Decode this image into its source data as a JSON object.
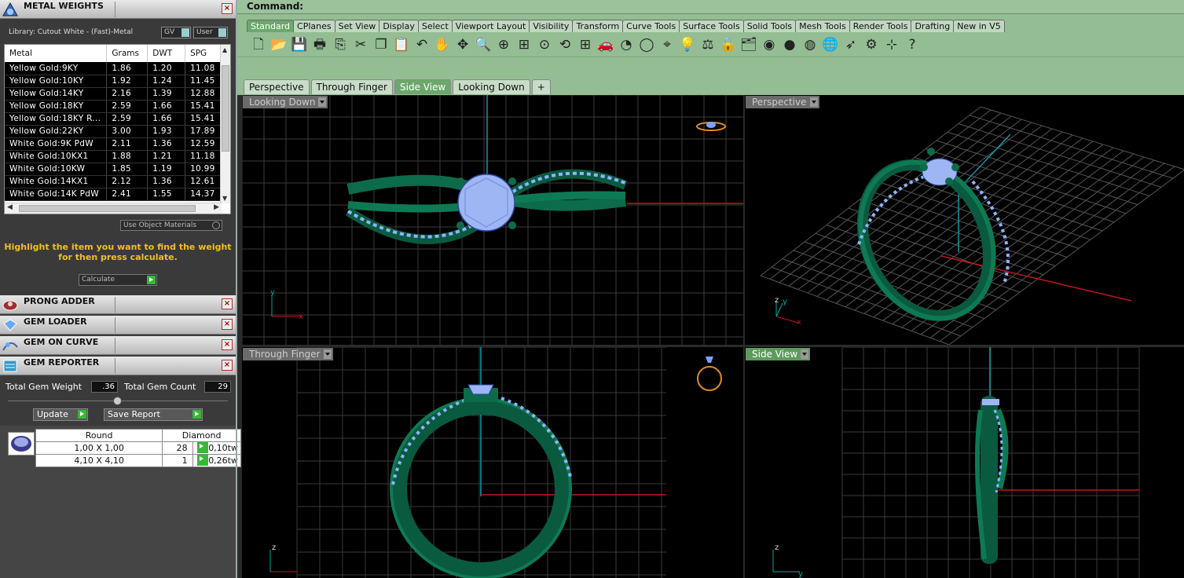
{
  "colors": {
    "accent": "#6ca86c",
    "ring": "#0c6b4a",
    "gem": "#a8c4ff",
    "hint": "#f0c020"
  },
  "metal_weights": {
    "title": "METAL WEIGHTS",
    "library": "Library: Cutout White - (Fast)-Metal",
    "gv": "GV",
    "user": "User",
    "headers": [
      "Metal",
      "Grams",
      "DWT",
      "SPG"
    ],
    "rows": [
      [
        "Yellow Gold:9KY",
        "1.86",
        "1.20",
        "11.08"
      ],
      [
        "Yellow Gold:10KY",
        "1.92",
        "1.24",
        "11.45"
      ],
      [
        "Yellow Gold:14KY",
        "2.16",
        "1.39",
        "12.88"
      ],
      [
        "Yellow Gold:18KY",
        "2.59",
        "1.66",
        "15.41"
      ],
      [
        "Yellow Gold:18KY R...",
        "2.59",
        "1.66",
        "15.41"
      ],
      [
        "Yellow Gold:22KY",
        "3.00",
        "1.93",
        "17.89"
      ],
      [
        "White Gold:9K PdW",
        "2.11",
        "1.36",
        "12.59"
      ],
      [
        "White Gold:10KX1",
        "1.88",
        "1.21",
        "11.18"
      ],
      [
        "White Gold:10KW",
        "1.85",
        "1.19",
        "10.99"
      ],
      [
        "White Gold:14KX1",
        "2.12",
        "1.36",
        "12.61"
      ],
      [
        "White Gold:14K PdW",
        "2.41",
        "1.55",
        "14.37"
      ]
    ],
    "use_object": "Use Object Materials",
    "hint1": "Highlight the item you want to find the weight",
    "hint2": "for then press calculate.",
    "calculate": "Calculate"
  },
  "panels": {
    "prong": "PRONG ADDER",
    "loader": "GEM LOADER",
    "curve": "GEM ON CURVE",
    "reporter": "GEM REPORTER"
  },
  "gem_reporter": {
    "total_weight_label": "Total Gem Weight",
    "total_weight": ".36",
    "total_count_label": "Total Gem Count",
    "total_count": "29",
    "update": "Update",
    "save": "Save Report",
    "headers": [
      "Round",
      "Diamond"
    ],
    "rows": [
      [
        "1,00 X 1,00",
        "28",
        "0,10tw"
      ],
      [
        "4,10 X 4,10",
        "1",
        "0,26tw"
      ]
    ]
  },
  "command_label": "Command:",
  "toolbar_tabs": [
    "Standard",
    "CPlanes",
    "Set View",
    "Display",
    "Select",
    "Viewport Layout",
    "Visibility",
    "Transform",
    "Curve Tools",
    "Surface Tools",
    "Solid Tools",
    "Mesh Tools",
    "Render Tools",
    "Drafting",
    "New in V5"
  ],
  "toolbar_icons": [
    "new-icon",
    "open-icon",
    "save-icon",
    "print-icon",
    "import-icon",
    "cut-icon",
    "copy-icon",
    "paste-icon",
    "undo-icon",
    "pan-hand-icon",
    "move-icon",
    "zoom-icon",
    "zoom-window-icon",
    "zoom-extents-icon",
    "zoom-selected-icon",
    "rotate-view-icon",
    "four-viewports-icon",
    "car-icon",
    "display-mode-icon",
    "sphere-icon",
    "dimension-icon",
    "light-bulb-icon",
    "weight-icon",
    "lock-icon",
    "layer-icon",
    "color-wheel-icon",
    "material-sphere-icon",
    "render-sphere-icon",
    "globe-icon",
    "cursor-icon",
    "settings-gears-icon",
    "snap-icon",
    "help-icon"
  ],
  "toolbar_glyphs": [
    "🗋",
    "📂",
    "💾",
    "🖶",
    "⎘",
    "✂",
    "❐",
    "📋",
    "↶",
    "✋",
    "✥",
    "🔍",
    "⊕",
    "⊞",
    "⊙",
    "⟲",
    "⊞",
    "🚗",
    "◔",
    "◯",
    "⌖",
    "💡",
    "⚖",
    "🔒",
    "🗂",
    "◉",
    "●",
    "◍",
    "🌐",
    "➶",
    "⚙",
    "⊹",
    "?"
  ],
  "viewport_tabs": [
    "Perspective",
    "Through Finger",
    "Side View",
    "Looking Down",
    "+"
  ],
  "viewports": {
    "top_left": "Looking Down",
    "top_right": "Perspective",
    "bottom_left": "Through Finger",
    "bottom_right": "Side View"
  },
  "axis": {
    "x": "x",
    "y": "y",
    "z": "z"
  }
}
